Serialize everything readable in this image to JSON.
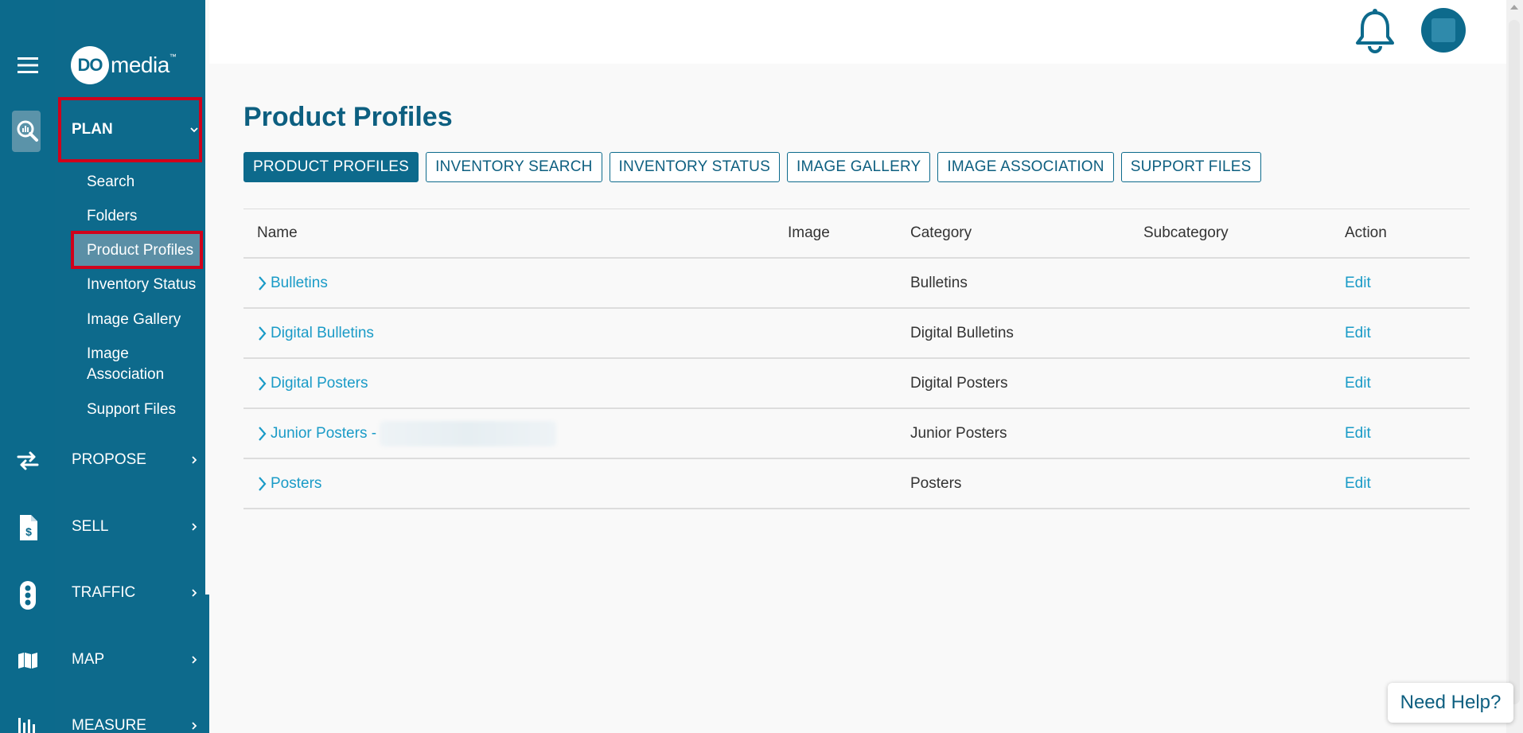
{
  "brand": {
    "logo_initials": "DO",
    "logo_text": "media",
    "logo_tm": "™"
  },
  "nav": {
    "plan": "PLAN",
    "plan_items": [
      "Search",
      "Folders",
      "Product Profiles",
      "Inventory Status",
      "Image Gallery",
      "Image\nAssociation",
      "Support Files"
    ],
    "image_association_line1": "Image",
    "image_association_line2": "Association",
    "propose": "PROPOSE",
    "sell": "SELL",
    "traffic": "TRAFFIC",
    "map": "MAP",
    "measure": "MEASURE"
  },
  "main": {
    "title": "Product Profiles",
    "tabs": [
      "PRODUCT PROFILES",
      "INVENTORY SEARCH",
      "INVENTORY STATUS",
      "IMAGE GALLERY",
      "IMAGE ASSOCIATION",
      "SUPPORT FILES"
    ],
    "active_tab": "PRODUCT PROFILES"
  },
  "table": {
    "headers": {
      "name": "Name",
      "image": "Image",
      "category": "Category",
      "subcategory": "Subcategory",
      "action": "Action"
    },
    "rows": [
      {
        "name": "Bulletins",
        "category": "Bulletins",
        "action": "Edit"
      },
      {
        "name": "Digital Bulletins",
        "category": "Digital Bulletins",
        "action": "Edit"
      },
      {
        "name": "Digital Posters",
        "category": "Digital Posters",
        "action": "Edit"
      },
      {
        "name": "Junior Posters -",
        "category": "Junior Posters",
        "action": "Edit"
      },
      {
        "name": "Posters",
        "category": "Posters",
        "action": "Edit"
      }
    ]
  },
  "help": {
    "label": "Need Help?"
  },
  "colors": {
    "sidebar": "#0d6a8c",
    "accent_link": "#1a9bc7",
    "highlight": "#d0021b",
    "title": "#0d5f80"
  }
}
